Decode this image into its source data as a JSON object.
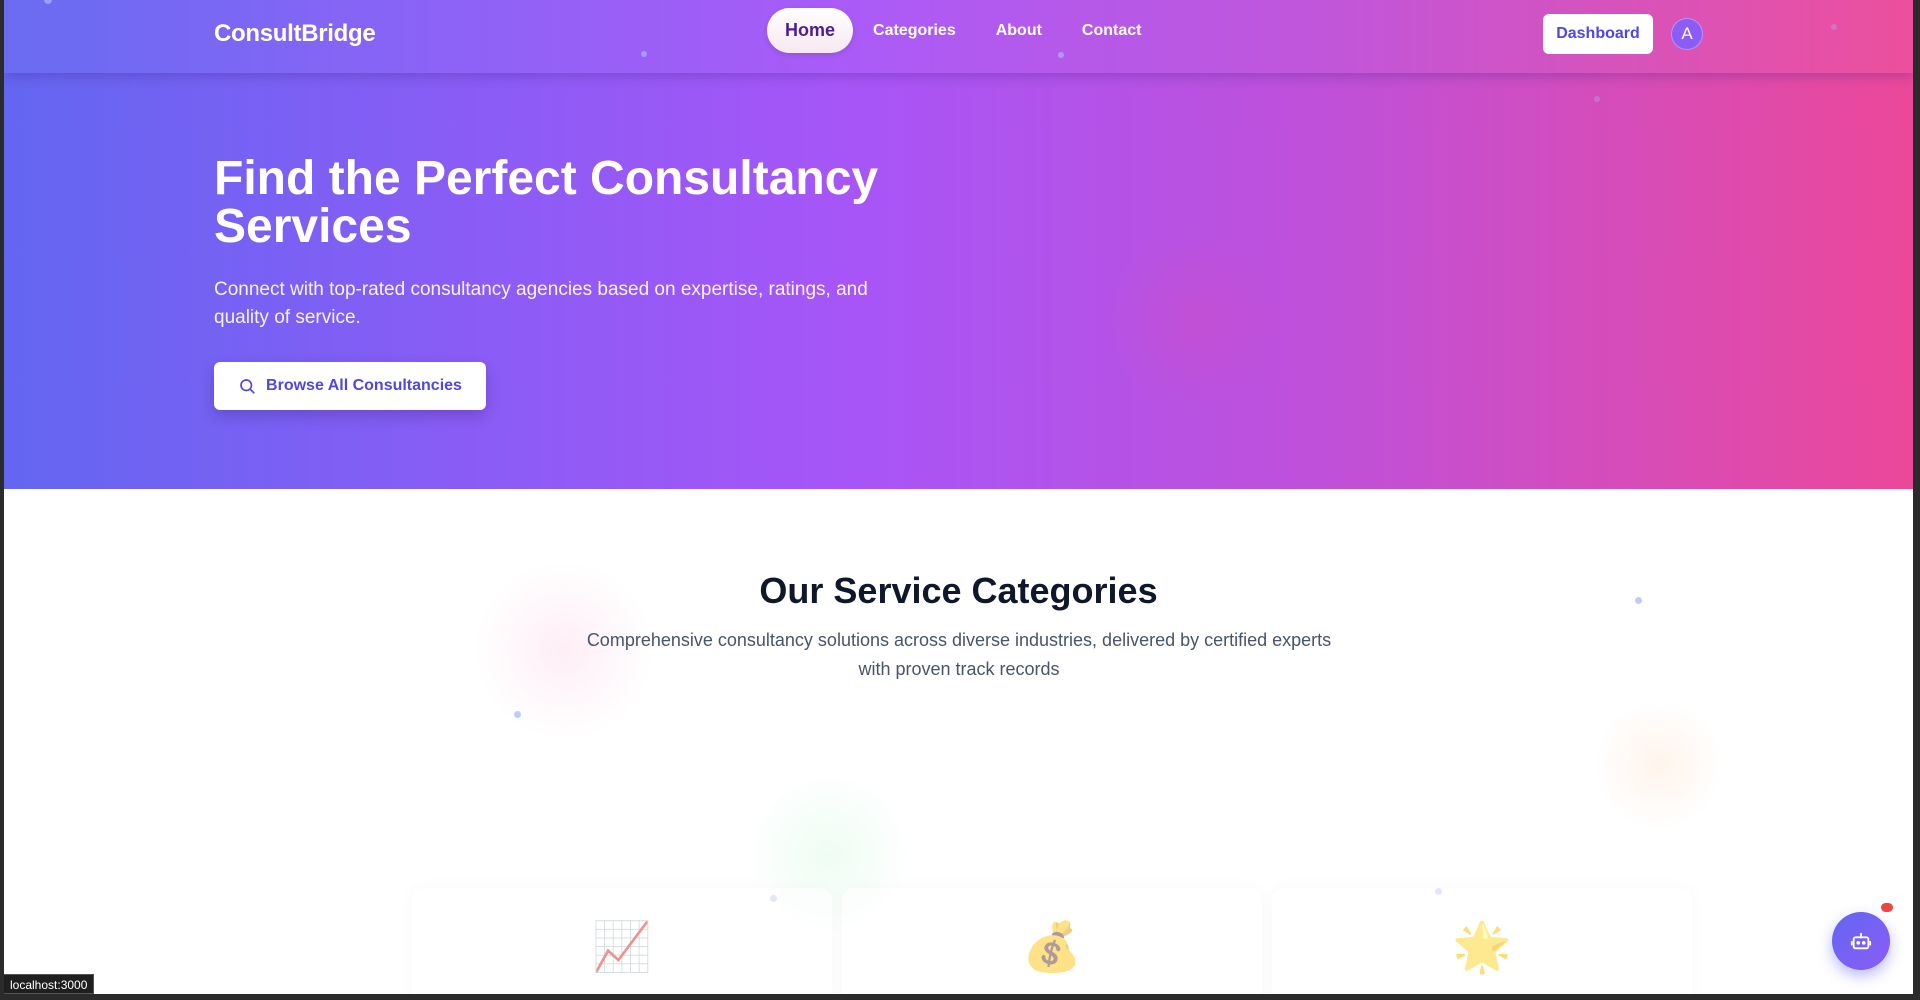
{
  "nav": {
    "brand": "ConsultBridge",
    "links": [
      {
        "label": "Home",
        "active": true
      },
      {
        "label": "Categories",
        "active": false
      },
      {
        "label": "About",
        "active": false
      },
      {
        "label": "Contact",
        "active": false
      }
    ],
    "dashboard_label": "Dashboard",
    "avatar_initial": "A"
  },
  "hero": {
    "title": "Find the Perfect Consultancy Services",
    "subtitle": "Connect with top-rated consultancy agencies based on expertise, ratings, and quality of service.",
    "cta_label": "Browse All Consultancies",
    "cta_icon": "search-icon"
  },
  "services": {
    "title": "Our Service Categories",
    "subtitle": "Comprehensive consultancy solutions across diverse industries, delivered by certified experts with proven track records",
    "cards": [
      {
        "icon": "📈",
        "icon_name": "chart-increasing-icon"
      },
      {
        "icon": "💰",
        "icon_name": "money-bag-icon"
      },
      {
        "icon": "🌟",
        "icon_name": "glowing-star-icon"
      }
    ]
  },
  "status_bar": {
    "url": "localhost:3000"
  },
  "chat": {
    "icon": "robot-icon"
  },
  "colors": {
    "gradient_start": "#6366f1",
    "gradient_mid": "#a855f7",
    "gradient_end": "#ec4899",
    "accent": "#4f46e5",
    "heading": "#0f172a"
  }
}
